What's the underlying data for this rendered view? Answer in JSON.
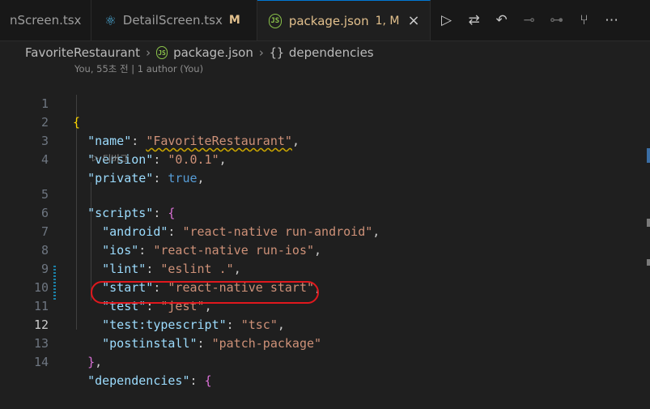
{
  "tabs": [
    {
      "label": "nScreen.tsx",
      "modified": "",
      "active": false
    },
    {
      "label": "DetailScreen.tsx",
      "modified": "M",
      "active": false,
      "icon": "react-icon"
    },
    {
      "label": "package.json",
      "modified": "1, M",
      "active": true,
      "icon": "json-icon"
    }
  ],
  "toolbar": {
    "icons": [
      "run-icon",
      "compare-changes-icon",
      "go-back-icon",
      "previous-change-icon",
      "next-change-icon",
      "git-graph-icon",
      "more-actions-icon"
    ]
  },
  "breadcrumb": {
    "folder": "FavoriteRestaurant",
    "file": "package.json",
    "symbol": "dependencies"
  },
  "blame": "You, 55초 전 | 1 author (You)",
  "codelens": "디버그",
  "lines": [
    {
      "n": "1"
    },
    {
      "n": "2"
    },
    {
      "n": "3"
    },
    {
      "n": "4"
    },
    {
      "n": "5"
    },
    {
      "n": "6"
    },
    {
      "n": "7"
    },
    {
      "n": "8"
    },
    {
      "n": "9"
    },
    {
      "n": "10"
    },
    {
      "n": "11"
    },
    {
      "n": "12"
    },
    {
      "n": "13"
    },
    {
      "n": "14"
    }
  ],
  "code": {
    "name_key": "\"name\"",
    "name_val": "\"FavoriteRestaurant\"",
    "version_key": "\"version\"",
    "version_val": "\"0.0.1\"",
    "private_key": "\"private\"",
    "private_val": "true",
    "scripts_key": "\"scripts\"",
    "android_key": "\"android\"",
    "android_val": "\"react-native run-android\"",
    "ios_key": "\"ios\"",
    "ios_val": "\"react-native run-ios\"",
    "lint_key": "\"lint\"",
    "lint_val": "\"eslint .\"",
    "start_key": "\"start\"",
    "start_val": "\"react-native start\"",
    "test_key": "\"test\"",
    "test_val": "\"jest\"",
    "typescript_key": "\"test:typescript\"",
    "typescript_val": "\"tsc\"",
    "postinstall_key": "\"postinstall\"",
    "postinstall_val": "\"patch-package\"",
    "dependencies_key": "\"dependencies\""
  },
  "colors": {
    "accent": "#0078d4",
    "highlight": "#e0181d",
    "modified": "#e2c08d"
  }
}
